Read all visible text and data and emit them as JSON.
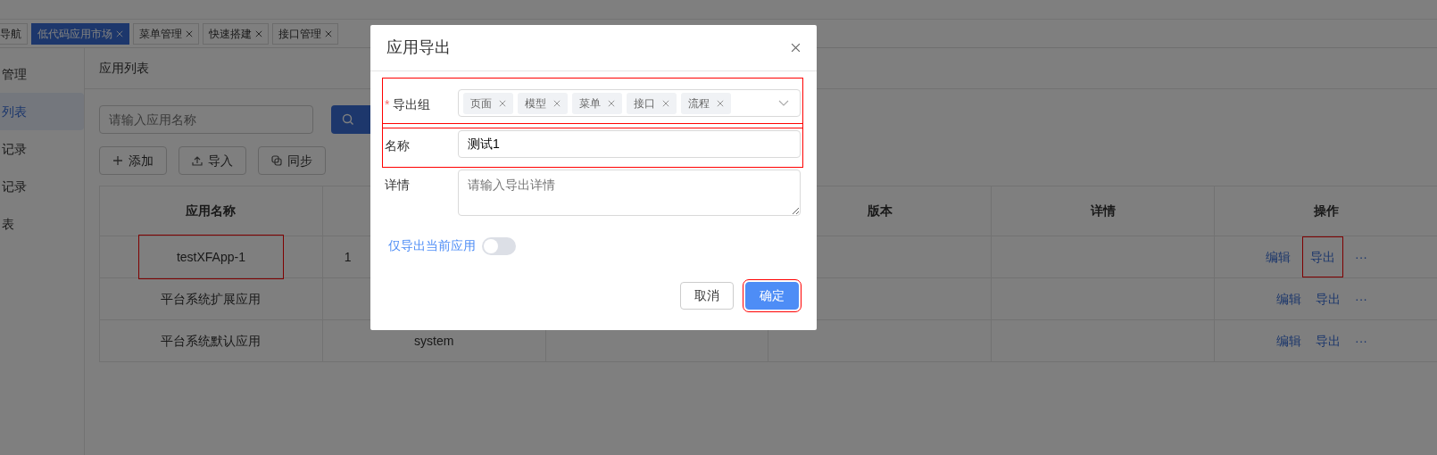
{
  "tabs": [
    {
      "label": "导航",
      "selected": false,
      "closable": false
    },
    {
      "label": "低代码应用市场",
      "selected": true,
      "closable": true
    },
    {
      "label": "菜单管理",
      "selected": false,
      "closable": true
    },
    {
      "label": "快速搭建",
      "selected": false,
      "closable": true
    },
    {
      "label": "接口管理",
      "selected": false,
      "closable": true
    }
  ],
  "sidebar": {
    "items": [
      {
        "label": "管理",
        "selected": false
      },
      {
        "label": "列表",
        "selected": true
      },
      {
        "label": "记录",
        "selected": false
      },
      {
        "label": "记录",
        "selected": false
      },
      {
        "label": "表",
        "selected": false
      }
    ]
  },
  "page": {
    "title": "应用列表",
    "search": {
      "placeholder": "请输入应用名称"
    },
    "toolbar": [
      {
        "label": "添加"
      },
      {
        "label": "导入"
      },
      {
        "label": "同步"
      }
    ]
  },
  "table": {
    "columns": [
      "应用名称",
      null,
      null,
      "版本",
      "详情",
      "操作"
    ],
    "rows": [
      {
        "cells": [
          "testXFApp-1",
          "1",
          null,
          null,
          null
        ],
        "highlighted": true,
        "actions": [
          {
            "label": "编辑",
            "highlighted": false
          },
          {
            "label": "导出",
            "highlighted": true
          },
          {
            "label": "···",
            "highlighted": false
          }
        ]
      },
      {
        "cells": [
          "平台系统扩展应用",
          null,
          null,
          null,
          null
        ],
        "highlighted": false,
        "actions": [
          {
            "label": "编辑",
            "highlighted": false
          },
          {
            "label": "导出",
            "highlighted": false
          },
          {
            "label": "···",
            "highlighted": false
          }
        ]
      },
      {
        "cells": [
          "平台系统默认应用",
          "system",
          null,
          null,
          null
        ],
        "highlighted": false,
        "actions": [
          {
            "label": "编辑",
            "highlighted": false
          },
          {
            "label": "导出",
            "highlighted": false
          },
          {
            "label": "···",
            "highlighted": false
          }
        ]
      }
    ]
  },
  "dialog": {
    "title": "应用导出",
    "fields": [
      {
        "kind": "tags",
        "marker": "*",
        "label": "导出组",
        "highlighted": true,
        "tags": [
          "页面",
          "模型",
          "菜单",
          "接口",
          "流程"
        ]
      },
      {
        "kind": "input",
        "label": "名称",
        "highlighted": true,
        "value": "测试1"
      },
      {
        "kind": "textarea",
        "label": "详情",
        "highlighted": false,
        "placeholder": "请输入导出详情"
      }
    ],
    "toggle": {
      "label": "仅导出当前应用",
      "on": false
    },
    "buttons": [
      {
        "label": "取消",
        "primary": false,
        "highlighted": false
      },
      {
        "label": "确定",
        "primary": true,
        "highlighted": true
      }
    ]
  }
}
